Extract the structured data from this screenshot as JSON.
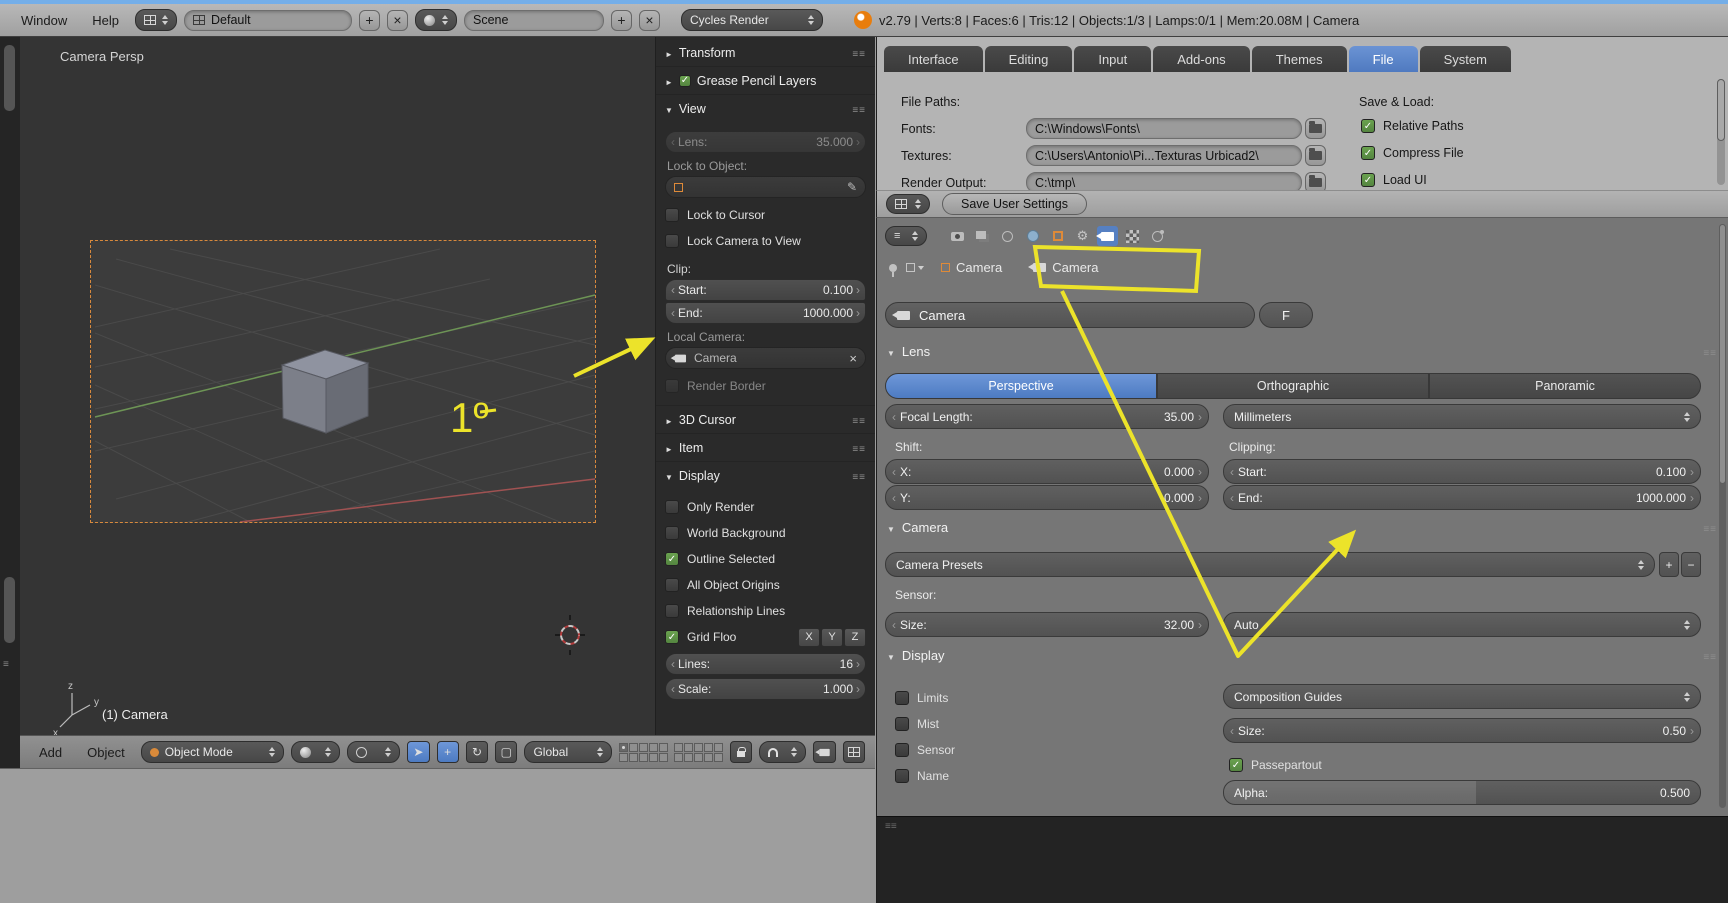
{
  "colors": {
    "accent_blue": "#5680c2",
    "check_green": "#5f9a49",
    "annotation_yellow": "#ece32a",
    "camera_border_orange": "#d8893c",
    "object_orange": "#e08c3a"
  },
  "topbar": {
    "menu_window": "Window",
    "menu_help": "Help",
    "layout_name": "Default",
    "scene_name": "Scene",
    "engine": "Cycles Render",
    "stats": "v2.79 | Verts:8 | Faces:6 | Tris:12 | Objects:1/3 | Lamps:0/1 | Mem:20.08M | Camera"
  },
  "viewport": {
    "view_label": "Camera Persp",
    "object_label": "(1) Camera",
    "axis_z": "z",
    "axis_y": "y",
    "axis_x": "x",
    "header": {
      "menu_add": "Add",
      "menu_object": "Object",
      "mode": "Object Mode",
      "orientation": "Global"
    }
  },
  "npanel": {
    "transform_title": "Transform",
    "grease_title": "Grease Pencil Layers",
    "view_title": "View",
    "lens_label": "Lens:",
    "lens_value": "35.000",
    "lock_to_object_label": "Lock to Object:",
    "lock_to_cursor": {
      "label": "Lock to Cursor",
      "checked": false
    },
    "lock_camera_to_view": {
      "label": "Lock Camera to View",
      "checked": false
    },
    "clip_label": "Clip:",
    "clip_start_label": "Start:",
    "clip_start_value": "0.100",
    "clip_end_label": "End:",
    "clip_end_value": "1000.000",
    "local_camera_label": "Local Camera:",
    "local_camera_value": "Camera",
    "render_border": {
      "label": "Render Border",
      "checked": false
    },
    "cursor_title": "3D Cursor",
    "item_title": "Item",
    "display_title": "Display",
    "chk_only_render": {
      "label": "Only Render",
      "checked": false
    },
    "chk_world_background": {
      "label": "World Background",
      "checked": false
    },
    "chk_outline_selected": {
      "label": "Outline Selected",
      "checked": true
    },
    "chk_all_object_origins": {
      "label": "All Object Origins",
      "checked": false
    },
    "chk_relationship_lines": {
      "label": "Relationship Lines",
      "checked": false
    },
    "chk_grid_floor": {
      "label": "Grid Floo",
      "checked": true
    },
    "axis_x_btn": "X",
    "axis_y_btn": "Y",
    "axis_z_btn": "Z",
    "lines_label": "Lines:",
    "lines_value": "16",
    "scale_label": "Scale:",
    "scale_value": "1.000"
  },
  "prefs": {
    "tabs": [
      {
        "label": "Interface"
      },
      {
        "label": "Editing"
      },
      {
        "label": "Input"
      },
      {
        "label": "Add-ons"
      },
      {
        "label": "Themes"
      },
      {
        "label": "File"
      },
      {
        "label": "System"
      }
    ],
    "active_tab": "File",
    "file_paths_label": "File Paths:",
    "fonts_label": "Fonts:",
    "fonts_value": "C:\\Windows\\Fonts\\",
    "textures_label": "Textures:",
    "textures_value": "C:\\Users\\Antonio\\Pi...Texturas Urbicad2\\",
    "render_output_label": "Render Output:",
    "render_output_value": "C:\\tmp\\",
    "save_load_label": "Save & Load:",
    "chk_relative_paths": {
      "label": "Relative Paths",
      "checked": true
    },
    "chk_compress_file": {
      "label": "Compress File",
      "checked": true
    },
    "chk_load_ui": {
      "label": "Load UI",
      "checked": true
    },
    "save_button": "Save User Settings"
  },
  "props": {
    "breadcrumb_object": "Camera",
    "breadcrumb_data": "Camera",
    "name_value": "Camera",
    "fake_user_label": "F",
    "lens": {
      "title": "Lens",
      "type_perspective": "Perspective",
      "type_orthographic": "Orthographic",
      "type_panoramic": "Panoramic",
      "active_type": "Perspective",
      "focal_label": "Focal Length:",
      "focal_value": "35.00",
      "unit_value": "Millimeters",
      "shift_label": "Shift:",
      "shift_x_label": "X:",
      "shift_x_value": "0.000",
      "shift_y_label": "Y:",
      "shift_y_value": "0.000",
      "clipping_label": "Clipping:",
      "clip_start_label": "Start:",
      "clip_start_value": "0.100",
      "clip_end_label": "End:",
      "clip_end_value": "1000.000"
    },
    "camera": {
      "title": "Camera",
      "presets_value": "Camera Presets",
      "sensor_label": "Sensor:",
      "size_label": "Size:",
      "size_value": "32.00",
      "fit_value": "Auto"
    },
    "display": {
      "title": "Display",
      "chk_limits": {
        "label": "Limits",
        "checked": false
      },
      "chk_mist": {
        "label": "Mist",
        "checked": false
      },
      "chk_sensor": {
        "label": "Sensor",
        "checked": false
      },
      "chk_name": {
        "label": "Name",
        "checked": false
      },
      "composition_value": "Composition Guides",
      "size_label": "Size:",
      "size_value": "0.50",
      "chk_passepartout": {
        "label": "Passepartout",
        "checked": true
      },
      "alpha_label": "Alpha:",
      "alpha_value": "0.500"
    }
  },
  "annotations": {
    "label": "1º"
  }
}
